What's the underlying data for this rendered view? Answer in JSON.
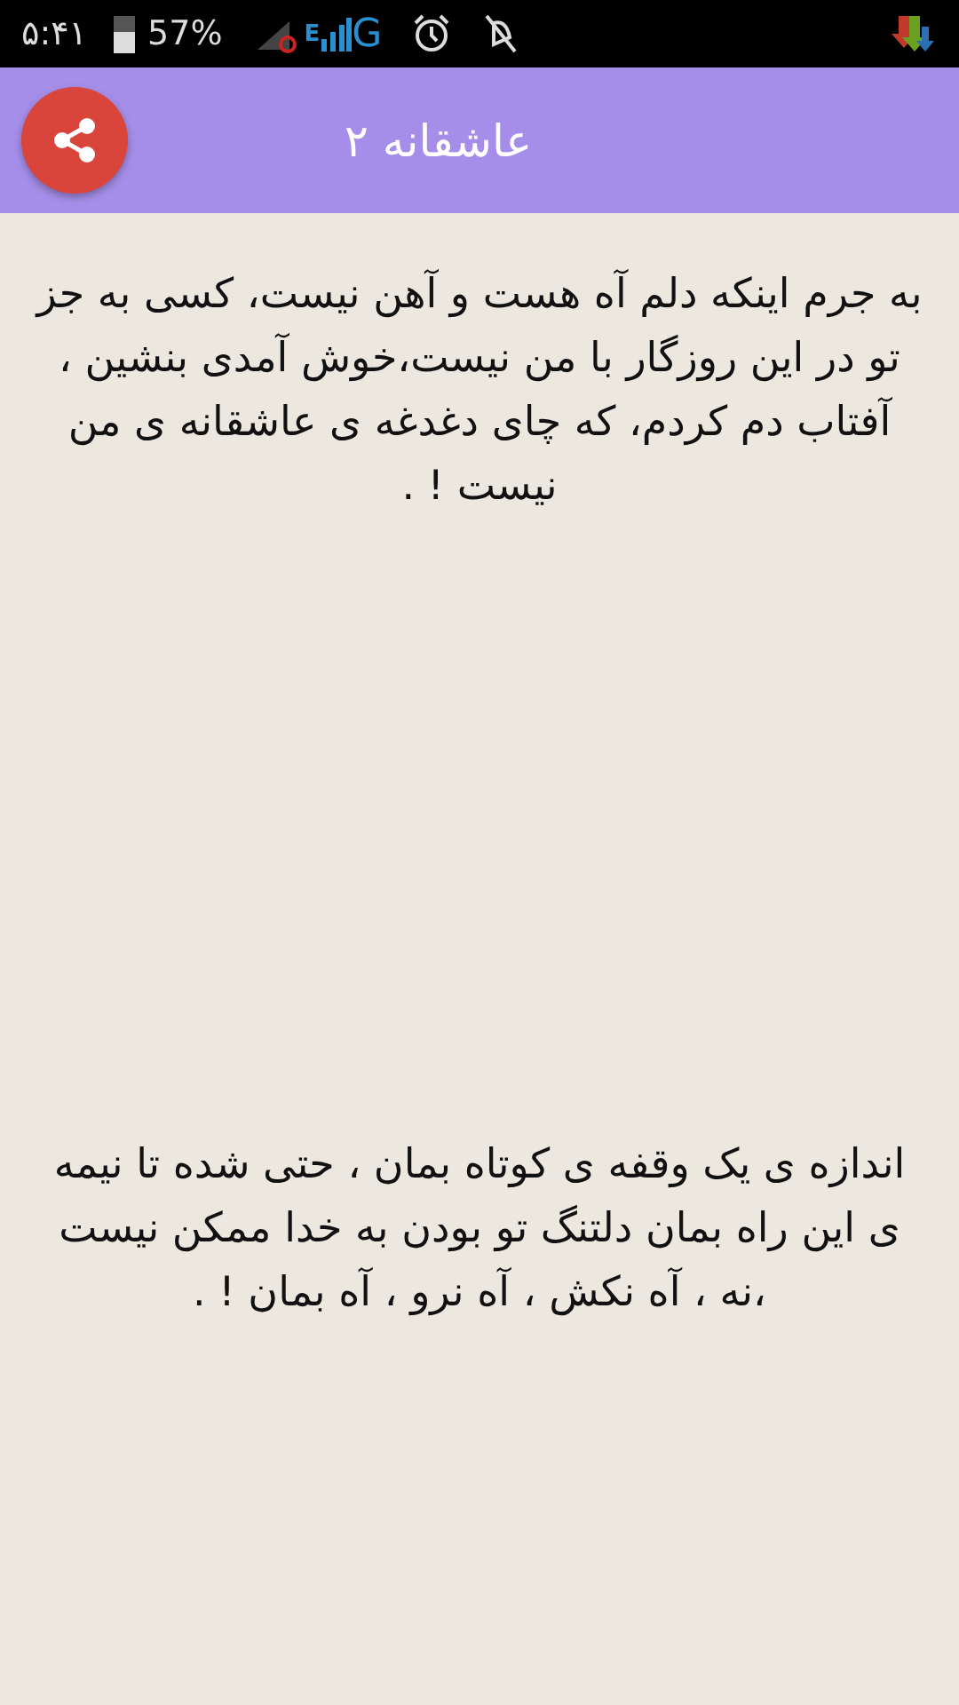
{
  "status_bar": {
    "time": "۵:۴۱",
    "battery": "57%",
    "network_type": [
      "G",
      "E"
    ]
  },
  "app_bar": {
    "title": "عاشقانه ۲"
  },
  "paragraphs": [
    "به جرم اینکه دلم آه هست و آهن نیست، کسی به جز تو در این روزگار با من نیست،خوش آمدی بنشین ، آفتاب دم کردم، که چای دغدغه ی عاشقانه ی من نیست ! .",
    "اندازه ی یک وقفه ی کوتاه بمان ، حتی شده تا نیمه ی این راه بمان دلتنگ تو بودن به خدا ممکن نیست ،نه ، آه نکش ، آه نرو ، آه بمان ! ."
  ]
}
